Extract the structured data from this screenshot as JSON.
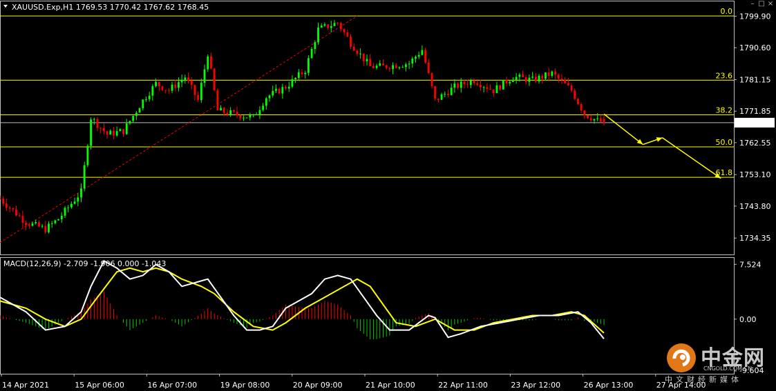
{
  "header": {
    "title": "XAUUSD.Exp,H1  1769.53 1770.42 1767.62 1768.45"
  },
  "colors": {
    "background": "#000000",
    "bull_candle": "#00ff00",
    "bear_candle": "#ff0000",
    "fib_line": "#ffff00",
    "trend_line": "#ff0000",
    "arrows": "#ffff00",
    "macd_line": "#ffffff",
    "signal_line": "#ffff00",
    "hist_positive": "#ff0000",
    "hist_negative": "#00cc00"
  },
  "watermark": {
    "name": "中金网",
    "url": "CNGOLD.COM.CN",
    "sub": "中文财经新媒体"
  },
  "chart_data": [
    {
      "type": "candlestick",
      "title": "XAUUSD.Exp,H1",
      "ohlc_last": {
        "open": 1769.53,
        "high": 1770.42,
        "low": 1767.62,
        "close": 1768.45
      },
      "last_price_label": "1768.45",
      "ylim": [
        1729.5,
        1804.5
      ],
      "y_ticks": [
        "1799.90",
        "1790.60",
        "1781.15",
        "1771.85",
        "1762.55",
        "1753.10",
        "1743.80",
        "1734.35"
      ],
      "x_ticks": [
        "14 Apr 2021",
        "15 Apr 06:00",
        "16 Apr 07:00",
        "19 Apr 08:00",
        "20 Apr 09:00",
        "21 Apr 10:00",
        "22 Apr 11:00",
        "23 Apr 12:00",
        "26 Apr 13:00",
        "27 Apr 14:00"
      ],
      "approx_close_path": [
        [
          0,
          1746
        ],
        [
          8,
          1739
        ],
        [
          14,
          1737
        ],
        [
          18,
          1740
        ],
        [
          25,
          1748
        ],
        [
          28,
          1770
        ],
        [
          33,
          1765
        ],
        [
          38,
          1766
        ],
        [
          44,
          1775
        ],
        [
          48,
          1780
        ],
        [
          52,
          1778
        ],
        [
          57,
          1782
        ],
        [
          61,
          1775
        ],
        [
          64,
          1789
        ],
        [
          67,
          1772
        ],
        [
          72,
          1771
        ],
        [
          78,
          1770
        ],
        [
          82,
          1776
        ],
        [
          88,
          1779
        ],
        [
          94,
          1784
        ],
        [
          98,
          1796
        ],
        [
          104,
          1798
        ],
        [
          108,
          1792
        ],
        [
          114,
          1785
        ],
        [
          118,
          1785
        ],
        [
          126,
          1786
        ],
        [
          130,
          1790
        ],
        [
          134,
          1775
        ],
        [
          140,
          1779
        ],
        [
          146,
          1781
        ],
        [
          152,
          1778
        ],
        [
          158,
          1782
        ],
        [
          164,
          1781
        ],
        [
          170,
          1783
        ],
        [
          176,
          1778
        ],
        [
          180,
          1771
        ],
        [
          184,
          1769
        ],
        [
          186,
          1768.45
        ]
      ],
      "fibonacci": [
        {
          "level": "0.0",
          "price": 1800.0
        },
        {
          "level": "23.6",
          "price": 1781.0
        },
        {
          "level": "38.2",
          "price": 1770.8
        },
        {
          "level": "50.0",
          "price": 1761.3
        },
        {
          "level": "61.8",
          "price": 1752.3
        }
      ],
      "trendline": {
        "from": [
          0,
          1733
        ],
        "to": [
          110,
          1800
        ]
      },
      "projection_arrows": [
        [
          186,
          1771
        ],
        [
          198,
          1762
        ],
        [
          204,
          1764
        ],
        [
          222,
          1752
        ]
      ]
    },
    {
      "type": "macd",
      "title": "MACD(12,26,9) -2.709 -1.906 0.000 -1.043",
      "ylim": [
        -7.5,
        8.5
      ],
      "y_ticks": [
        "7.524",
        "0.00",
        "-9.604"
      ],
      "macd_line": [
        [
          0,
          3.0
        ],
        [
          8,
          1.0
        ],
        [
          14,
          -1.5
        ],
        [
          20,
          -1.0
        ],
        [
          25,
          1.0
        ],
        [
          28,
          4.5
        ],
        [
          32,
          8.0
        ],
        [
          36,
          7.0
        ],
        [
          40,
          5.5
        ],
        [
          44,
          6.0
        ],
        [
          48,
          7.5
        ],
        [
          52,
          6.5
        ],
        [
          56,
          4.5
        ],
        [
          60,
          5.0
        ],
        [
          64,
          5.5
        ],
        [
          68,
          3.0
        ],
        [
          72,
          0.5
        ],
        [
          76,
          -1.5
        ],
        [
          80,
          -1.5
        ],
        [
          84,
          -1.0
        ],
        [
          88,
          1.5
        ],
        [
          92,
          2.5
        ],
        [
          96,
          3.5
        ],
        [
          100,
          5.5
        ],
        [
          104,
          6.0
        ],
        [
          108,
          5.5
        ],
        [
          112,
          3.0
        ],
        [
          116,
          0.5
        ],
        [
          120,
          -1.5
        ],
        [
          126,
          -1.5
        ],
        [
          132,
          0.5
        ],
        [
          134,
          0.2
        ],
        [
          138,
          -2.5
        ],
        [
          142,
          -2.0
        ],
        [
          148,
          -1.0
        ],
        [
          154,
          -0.5
        ],
        [
          160,
          0.0
        ],
        [
          166,
          0.5
        ],
        [
          172,
          0.5
        ],
        [
          178,
          1.0
        ],
        [
          182,
          -0.5
        ],
        [
          186,
          -2.7
        ]
      ],
      "signal_line": [
        [
          0,
          2.5
        ],
        [
          8,
          1.5
        ],
        [
          14,
          0.0
        ],
        [
          20,
          -1.0
        ],
        [
          25,
          0.0
        ],
        [
          30,
          3.0
        ],
        [
          36,
          6.5
        ],
        [
          40,
          7.0
        ],
        [
          44,
          6.5
        ],
        [
          48,
          7.0
        ],
        [
          52,
          6.5
        ],
        [
          56,
          5.5
        ],
        [
          62,
          4.5
        ],
        [
          66,
          3.5
        ],
        [
          72,
          1.0
        ],
        [
          78,
          -1.0
        ],
        [
          84,
          -1.5
        ],
        [
          88,
          -0.5
        ],
        [
          94,
          1.5
        ],
        [
          100,
          3.0
        ],
        [
          106,
          4.5
        ],
        [
          110,
          5.5
        ],
        [
          114,
          4.5
        ],
        [
          118,
          2.0
        ],
        [
          122,
          -0.5
        ],
        [
          128,
          -1.0
        ],
        [
          134,
          0.0
        ],
        [
          140,
          -1.5
        ],
        [
          146,
          -1.5
        ],
        [
          152,
          -0.5
        ],
        [
          158,
          0.0
        ],
        [
          164,
          0.5
        ],
        [
          170,
          0.5
        ],
        [
          176,
          1.0
        ],
        [
          180,
          0.5
        ],
        [
          186,
          -1.9
        ]
      ],
      "histogram_note": "bars = macd - signal"
    }
  ]
}
